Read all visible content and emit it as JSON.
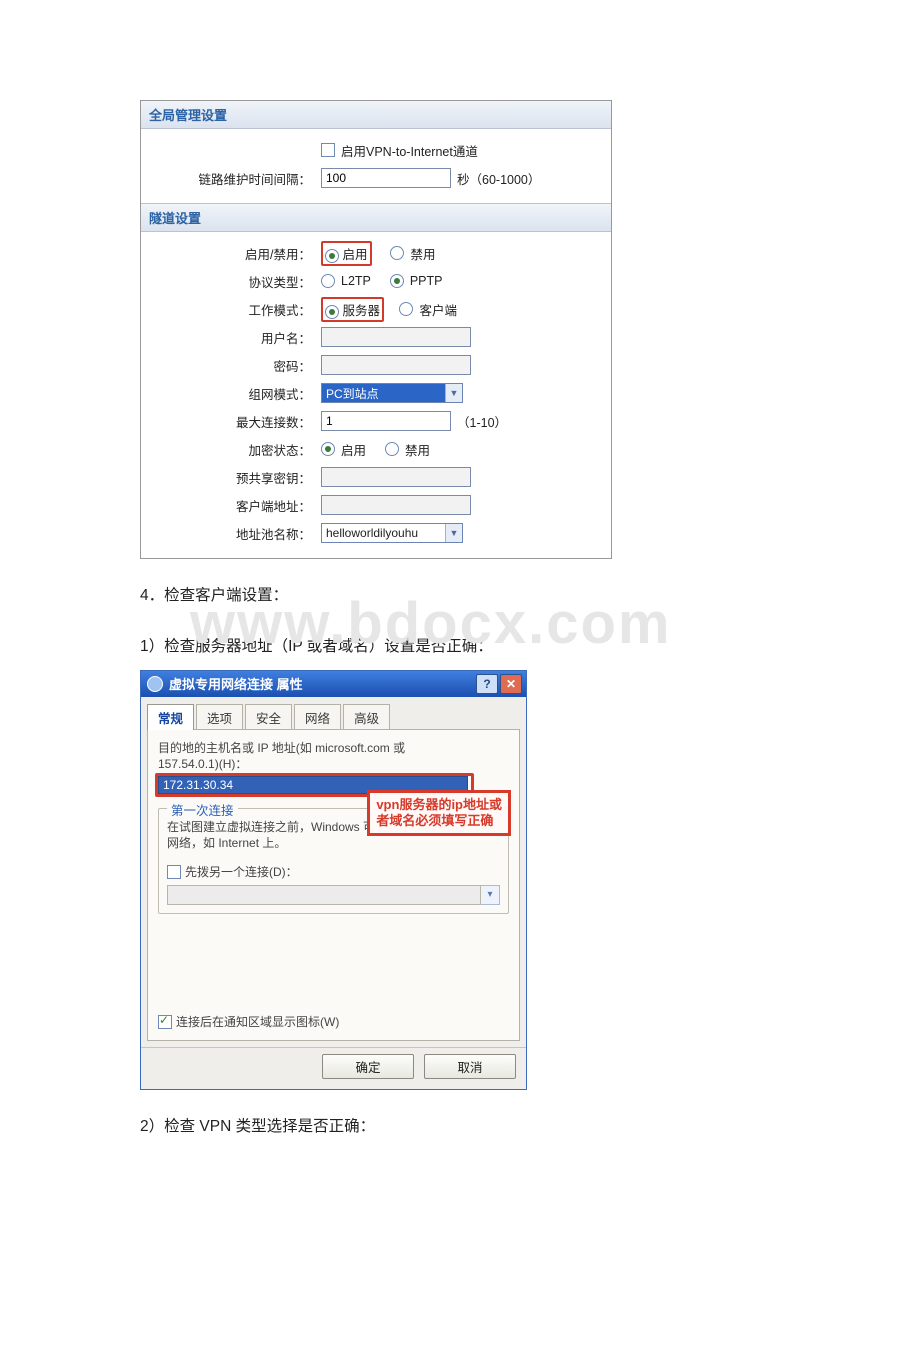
{
  "watermark": "www.bdocx.com",
  "router": {
    "section_global": "全局管理设置",
    "enable_vpn_to_internet": "启用VPN-to-Internet通道",
    "link_interval_label": "链路维护时间间隔：",
    "link_interval_value": "100",
    "link_interval_unit": "秒（60-1000）",
    "section_tunnel": "隧道设置",
    "enable_label": "启用/禁用：",
    "enable_opt1": "启用",
    "enable_opt2": "禁用",
    "proto_label": "协议类型：",
    "proto_opt1": "L2TP",
    "proto_opt2": "PPTP",
    "mode_label": "工作模式：",
    "mode_opt1": "服务器",
    "mode_opt2": "客户端",
    "user_label": "用户名：",
    "pwd_label": "密码：",
    "netmode_label": "组网模式：",
    "netmode_value": "PC到站点",
    "maxconn_label": "最大连接数：",
    "maxconn_value": "1",
    "maxconn_unit": "（1-10）",
    "enc_label": "加密状态：",
    "enc_opt1": "启用",
    "enc_opt2": "禁用",
    "psk_label": "预共享密钥：",
    "clientaddr_label": "客户端地址：",
    "pool_label": "地址池名称：",
    "pool_value": "helloworldilyouhu"
  },
  "steps": {
    "s4": "4．检查客户端设置：",
    "s4_1": "1）检查服务器地址（IP 或者域名）设置是否正确：",
    "s4_2": "2）检查 VPN 类型选择是否正确："
  },
  "dialog": {
    "title": "虚拟专用网络连接 属性",
    "tabs": {
      "general": "常规",
      "options": "选项",
      "security": "安全",
      "network": "网络",
      "advanced": "高级"
    },
    "host_desc1": "目的地的主机名或 IP 地址(如 microsoft.com 或",
    "host_desc2": "157.54.0.1)(H)：",
    "host_value": "172.31.30.34",
    "callout_line1": "vpn服务器的ip地址或",
    "callout_line2": "者域名必须填写正确",
    "first_conn_legend": "第一次连接",
    "first_conn_desc1": "在试图建立虚拟连接之前，Windows 可以先连接到公用",
    "first_conn_desc2": "网络，如 Internet 上。",
    "dial_first_label": "先拨另一个连接(D)：",
    "show_icon_label": "连接后在通知区域显示图标(W)",
    "ok": "确定",
    "cancel": "取消"
  }
}
